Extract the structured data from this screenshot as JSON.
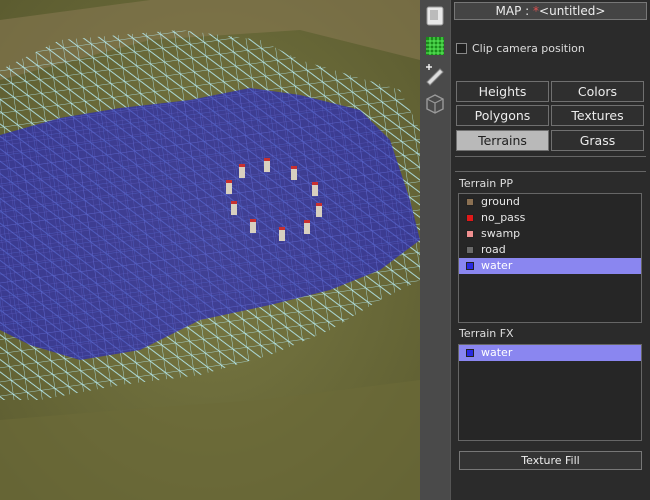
{
  "header": {
    "map_prefix": "MAP : ",
    "modified_mark": "*",
    "map_name": "<untitled>"
  },
  "options": {
    "clip_camera_label": "Clip camera position",
    "clip_camera_checked": false
  },
  "modes": {
    "heights": "Heights",
    "colors": "Colors",
    "polygons": "Polygons",
    "textures": "Textures",
    "terrains": "Terrains",
    "grass": "Grass",
    "active": "Terrains"
  },
  "terrain_pp": {
    "title": "Terrain PP",
    "items": [
      {
        "label": "ground",
        "color": "#8a7052"
      },
      {
        "label": "no_pass",
        "color": "#e01818"
      },
      {
        "label": "swamp",
        "color": "#f09090"
      },
      {
        "label": "road",
        "color": "#6a6a6a"
      },
      {
        "label": "water",
        "color": "#2a2ae0",
        "selected": true
      }
    ]
  },
  "terrain_fx": {
    "title": "Terrain FX",
    "items": [
      {
        "label": "water",
        "color": "#2a2ae0",
        "selected": true
      }
    ]
  },
  "actions": {
    "texture_fill": "Texture Fill"
  },
  "toolbar": {
    "tools": [
      "camera-icon",
      "grid-icon",
      "brush-icon",
      "cube-icon"
    ]
  },
  "colors": {
    "water_overlay": "#2a2ab0",
    "wire": "#a8e8f0",
    "grass": "#6a6a36",
    "selection": "#8a86f0"
  }
}
